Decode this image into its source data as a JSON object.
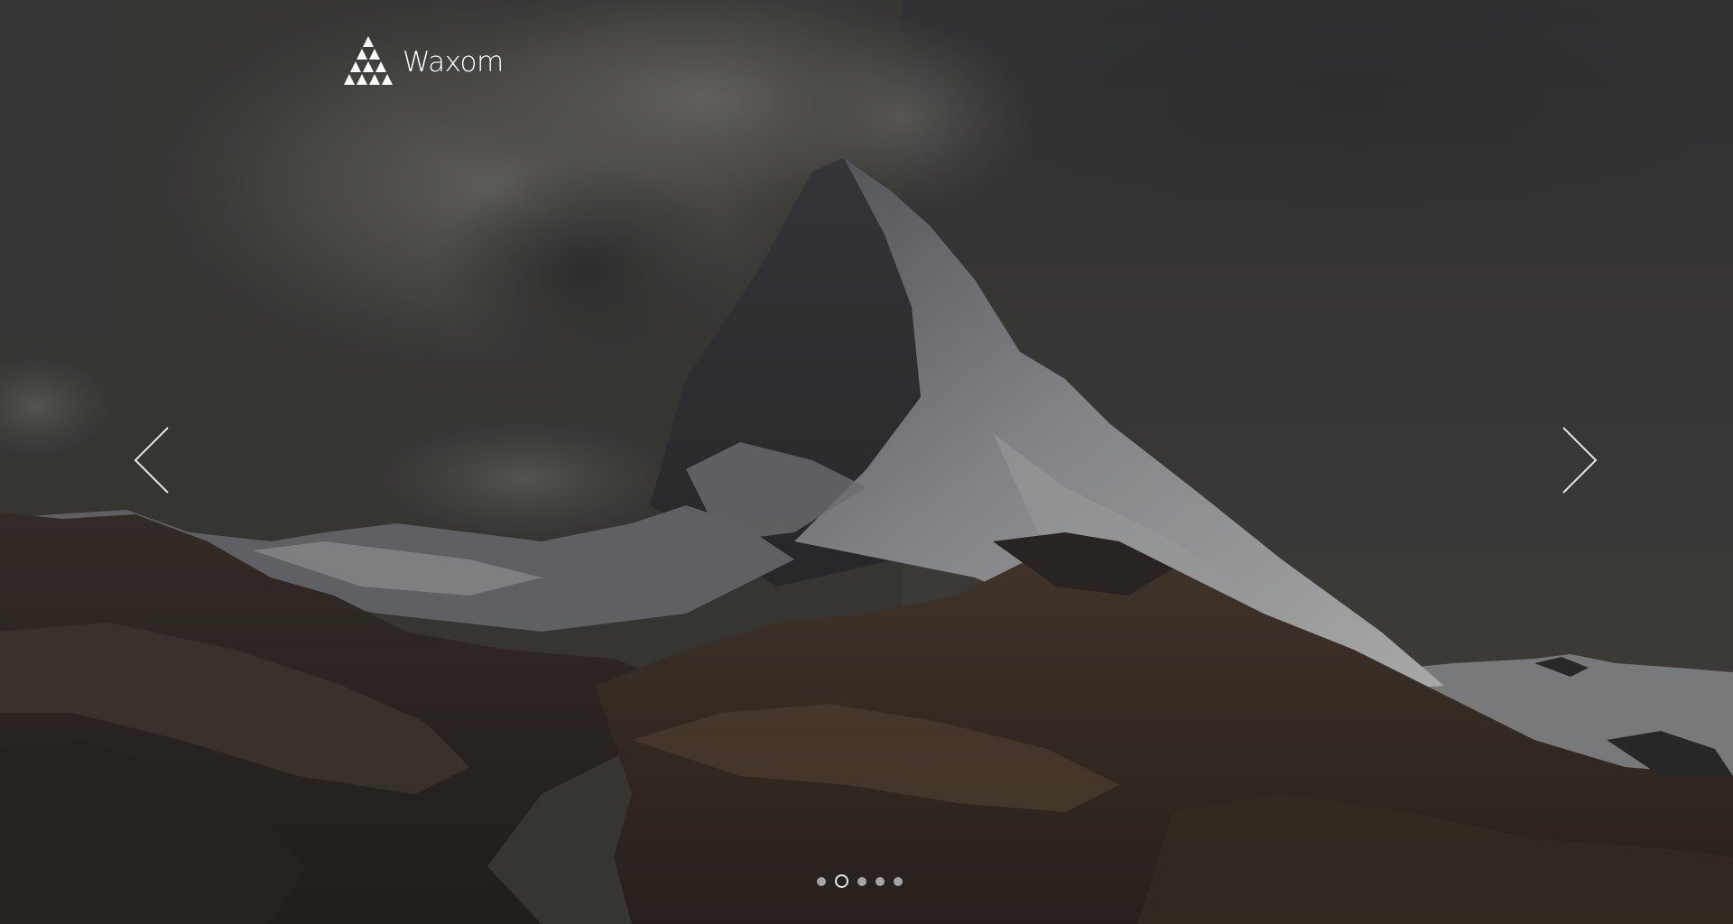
{
  "brand": {
    "name": "Waxom",
    "logo_icon": "triangle-logo-icon"
  },
  "slider": {
    "prev_icon": "chevron-left-icon",
    "next_icon": "chevron-right-icon",
    "slide_count": 5,
    "active_index": 1
  },
  "colors": {
    "arrow": "#e8e4df",
    "dot": "#d2d2d2",
    "dot_active_border": "#e6e6e6",
    "logo": "#ffffff"
  }
}
